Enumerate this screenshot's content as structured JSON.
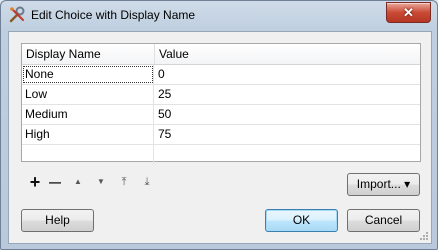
{
  "window": {
    "title": "Edit Choice with Display Name"
  },
  "table": {
    "headers": [
      "Display Name",
      "Value"
    ],
    "rows": [
      {
        "name": "None",
        "value": "0"
      },
      {
        "name": "Low",
        "value": "25"
      },
      {
        "name": "Medium",
        "value": "50"
      },
      {
        "name": "High",
        "value": "75"
      }
    ]
  },
  "toolbar": {
    "add": "+",
    "remove": "—",
    "move_up": "▲",
    "move_down": "▼",
    "move_top": "⤒",
    "move_bottom": "⤓"
  },
  "buttons": {
    "import_label": "Import...",
    "import_arrow": "▾",
    "help_label": "Help",
    "ok_label": "OK",
    "cancel_label": "Cancel",
    "close_glyph": "✕"
  }
}
